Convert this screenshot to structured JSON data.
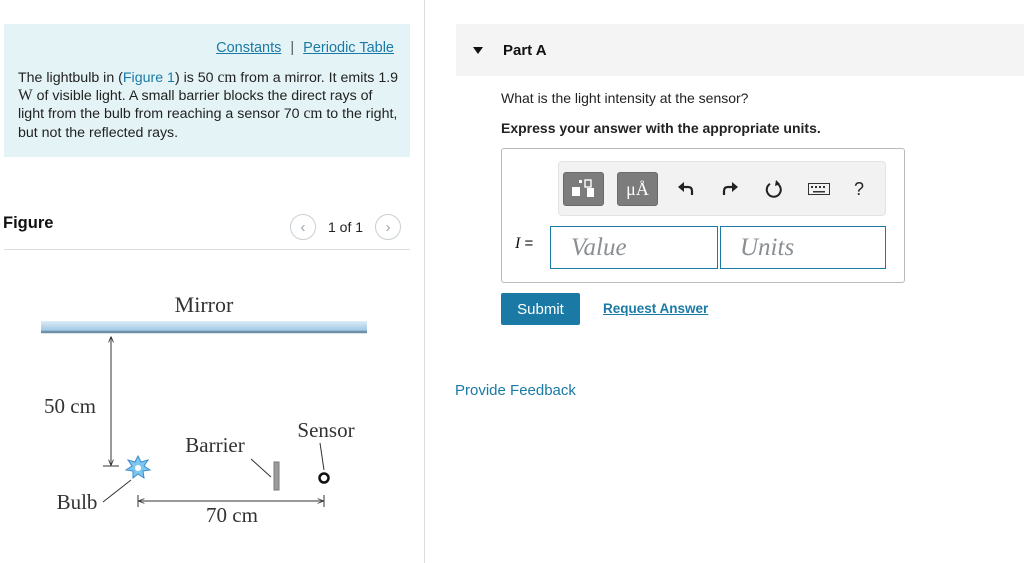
{
  "problem": {
    "links": {
      "constants": "Constants",
      "separator": "|",
      "periodic_table": "Periodic Table"
    },
    "text": {
      "t1": "The lightbulb in (",
      "figure_link": "Figure 1",
      "t2": ") is 50 ",
      "u1": "cm",
      "t3": " from a mirror. It emits 1.9 ",
      "u2": "W",
      "t4": " of visible light. A small barrier blocks the direct rays of light from the bulb from reaching a sensor 70 ",
      "u3": "cm",
      "t5": " to the right, but not the reflected rays."
    }
  },
  "figure": {
    "title": "Figure",
    "counter": "1 of 1",
    "prev_icon": "chevron-left-icon",
    "next_icon": "chevron-right-icon",
    "labels": {
      "mirror": "Mirror",
      "distance_vertical": "50 cm",
      "barrier": "Barrier",
      "sensor": "Sensor",
      "bulb": "Bulb",
      "distance_horizontal": "70 cm"
    }
  },
  "part": {
    "title": "Part A",
    "question": "What is the light intensity at the sensor?",
    "instruction": "Express your answer with the appropriate units.",
    "toolbar": {
      "templates_icon": "templates-icon",
      "units_button": "μÅ",
      "undo_icon": "undo-icon",
      "redo_icon": "redo-icon",
      "reset_icon": "reset-icon",
      "keyboard_icon": "keyboard-icon",
      "help": "?"
    },
    "answer": {
      "variable": "I",
      "equals": "=",
      "value_placeholder": "Value",
      "units_placeholder": "Units"
    },
    "submit": "Submit",
    "request_answer": "Request Answer"
  },
  "feedback": "Provide Feedback",
  "colors": {
    "accent": "#1a7aa5",
    "problem_bg": "#e4f4f6",
    "mirror": "#a9cce6"
  }
}
